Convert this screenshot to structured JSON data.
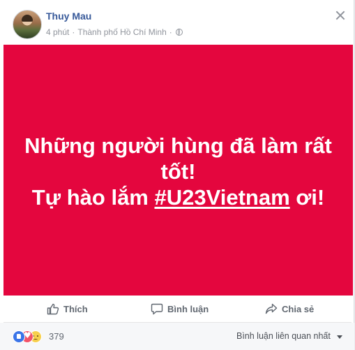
{
  "post": {
    "author": "Thuy Mau",
    "time": "4 phút",
    "location": "Thành phố Hồ Chí Minh",
    "banner": {
      "line1": "Những người hùng đã làm rất",
      "line2": "tốt!",
      "line3_prefix": "Tự hào lắm ",
      "hashtag": "#U23Vietnam",
      "line3_suffix": " ơi!",
      "background_color": "#e4063e"
    }
  },
  "actions": {
    "like": "Thích",
    "comment": "Bình luận",
    "share": "Chia sẻ"
  },
  "footer": {
    "reaction_icons": [
      "like-icon",
      "love-icon",
      "sad-icon"
    ],
    "reaction_count": "379",
    "sort_label": "Bình luận liên quan nhất"
  }
}
